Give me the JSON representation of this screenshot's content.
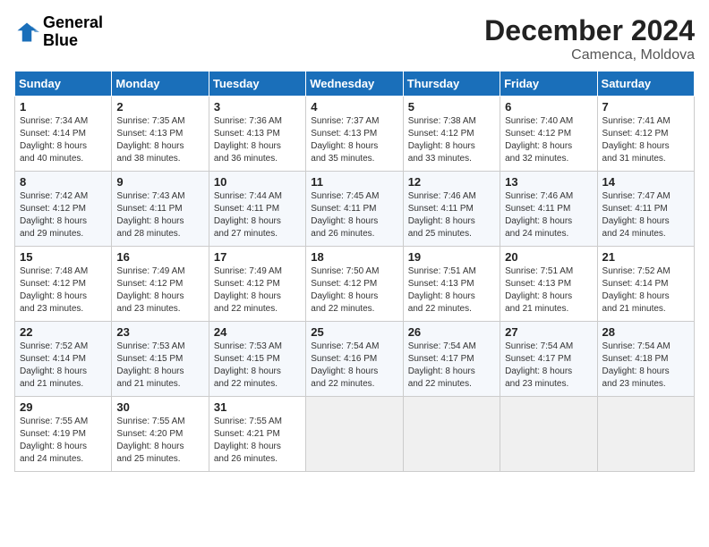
{
  "header": {
    "logo_line1": "General",
    "logo_line2": "Blue",
    "month_year": "December 2024",
    "location": "Camenca, Moldova"
  },
  "days_of_week": [
    "Sunday",
    "Monday",
    "Tuesday",
    "Wednesday",
    "Thursday",
    "Friday",
    "Saturday"
  ],
  "weeks": [
    [
      {
        "day": "1",
        "lines": [
          "Sunrise: 7:34 AM",
          "Sunset: 4:14 PM",
          "Daylight: 8 hours",
          "and 40 minutes."
        ]
      },
      {
        "day": "2",
        "lines": [
          "Sunrise: 7:35 AM",
          "Sunset: 4:13 PM",
          "Daylight: 8 hours",
          "and 38 minutes."
        ]
      },
      {
        "day": "3",
        "lines": [
          "Sunrise: 7:36 AM",
          "Sunset: 4:13 PM",
          "Daylight: 8 hours",
          "and 36 minutes."
        ]
      },
      {
        "day": "4",
        "lines": [
          "Sunrise: 7:37 AM",
          "Sunset: 4:13 PM",
          "Daylight: 8 hours",
          "and 35 minutes."
        ]
      },
      {
        "day": "5",
        "lines": [
          "Sunrise: 7:38 AM",
          "Sunset: 4:12 PM",
          "Daylight: 8 hours",
          "and 33 minutes."
        ]
      },
      {
        "day": "6",
        "lines": [
          "Sunrise: 7:40 AM",
          "Sunset: 4:12 PM",
          "Daylight: 8 hours",
          "and 32 minutes."
        ]
      },
      {
        "day": "7",
        "lines": [
          "Sunrise: 7:41 AM",
          "Sunset: 4:12 PM",
          "Daylight: 8 hours",
          "and 31 minutes."
        ]
      }
    ],
    [
      {
        "day": "8",
        "lines": [
          "Sunrise: 7:42 AM",
          "Sunset: 4:12 PM",
          "Daylight: 8 hours",
          "and 29 minutes."
        ]
      },
      {
        "day": "9",
        "lines": [
          "Sunrise: 7:43 AM",
          "Sunset: 4:11 PM",
          "Daylight: 8 hours",
          "and 28 minutes."
        ]
      },
      {
        "day": "10",
        "lines": [
          "Sunrise: 7:44 AM",
          "Sunset: 4:11 PM",
          "Daylight: 8 hours",
          "and 27 minutes."
        ]
      },
      {
        "day": "11",
        "lines": [
          "Sunrise: 7:45 AM",
          "Sunset: 4:11 PM",
          "Daylight: 8 hours",
          "and 26 minutes."
        ]
      },
      {
        "day": "12",
        "lines": [
          "Sunrise: 7:46 AM",
          "Sunset: 4:11 PM",
          "Daylight: 8 hours",
          "and 25 minutes."
        ]
      },
      {
        "day": "13",
        "lines": [
          "Sunrise: 7:46 AM",
          "Sunset: 4:11 PM",
          "Daylight: 8 hours",
          "and 24 minutes."
        ]
      },
      {
        "day": "14",
        "lines": [
          "Sunrise: 7:47 AM",
          "Sunset: 4:11 PM",
          "Daylight: 8 hours",
          "and 24 minutes."
        ]
      }
    ],
    [
      {
        "day": "15",
        "lines": [
          "Sunrise: 7:48 AM",
          "Sunset: 4:12 PM",
          "Daylight: 8 hours",
          "and 23 minutes."
        ]
      },
      {
        "day": "16",
        "lines": [
          "Sunrise: 7:49 AM",
          "Sunset: 4:12 PM",
          "Daylight: 8 hours",
          "and 23 minutes."
        ]
      },
      {
        "day": "17",
        "lines": [
          "Sunrise: 7:49 AM",
          "Sunset: 4:12 PM",
          "Daylight: 8 hours",
          "and 22 minutes."
        ]
      },
      {
        "day": "18",
        "lines": [
          "Sunrise: 7:50 AM",
          "Sunset: 4:12 PM",
          "Daylight: 8 hours",
          "and 22 minutes."
        ]
      },
      {
        "day": "19",
        "lines": [
          "Sunrise: 7:51 AM",
          "Sunset: 4:13 PM",
          "Daylight: 8 hours",
          "and 22 minutes."
        ]
      },
      {
        "day": "20",
        "lines": [
          "Sunrise: 7:51 AM",
          "Sunset: 4:13 PM",
          "Daylight: 8 hours",
          "and 21 minutes."
        ]
      },
      {
        "day": "21",
        "lines": [
          "Sunrise: 7:52 AM",
          "Sunset: 4:14 PM",
          "Daylight: 8 hours",
          "and 21 minutes."
        ]
      }
    ],
    [
      {
        "day": "22",
        "lines": [
          "Sunrise: 7:52 AM",
          "Sunset: 4:14 PM",
          "Daylight: 8 hours",
          "and 21 minutes."
        ]
      },
      {
        "day": "23",
        "lines": [
          "Sunrise: 7:53 AM",
          "Sunset: 4:15 PM",
          "Daylight: 8 hours",
          "and 21 minutes."
        ]
      },
      {
        "day": "24",
        "lines": [
          "Sunrise: 7:53 AM",
          "Sunset: 4:15 PM",
          "Daylight: 8 hours",
          "and 22 minutes."
        ]
      },
      {
        "day": "25",
        "lines": [
          "Sunrise: 7:54 AM",
          "Sunset: 4:16 PM",
          "Daylight: 8 hours",
          "and 22 minutes."
        ]
      },
      {
        "day": "26",
        "lines": [
          "Sunrise: 7:54 AM",
          "Sunset: 4:17 PM",
          "Daylight: 8 hours",
          "and 22 minutes."
        ]
      },
      {
        "day": "27",
        "lines": [
          "Sunrise: 7:54 AM",
          "Sunset: 4:17 PM",
          "Daylight: 8 hours",
          "and 23 minutes."
        ]
      },
      {
        "day": "28",
        "lines": [
          "Sunrise: 7:54 AM",
          "Sunset: 4:18 PM",
          "Daylight: 8 hours",
          "and 23 minutes."
        ]
      }
    ],
    [
      {
        "day": "29",
        "lines": [
          "Sunrise: 7:55 AM",
          "Sunset: 4:19 PM",
          "Daylight: 8 hours",
          "and 24 minutes."
        ]
      },
      {
        "day": "30",
        "lines": [
          "Sunrise: 7:55 AM",
          "Sunset: 4:20 PM",
          "Daylight: 8 hours",
          "and 25 minutes."
        ]
      },
      {
        "day": "31",
        "lines": [
          "Sunrise: 7:55 AM",
          "Sunset: 4:21 PM",
          "Daylight: 8 hours",
          "and 26 minutes."
        ]
      },
      null,
      null,
      null,
      null
    ]
  ]
}
